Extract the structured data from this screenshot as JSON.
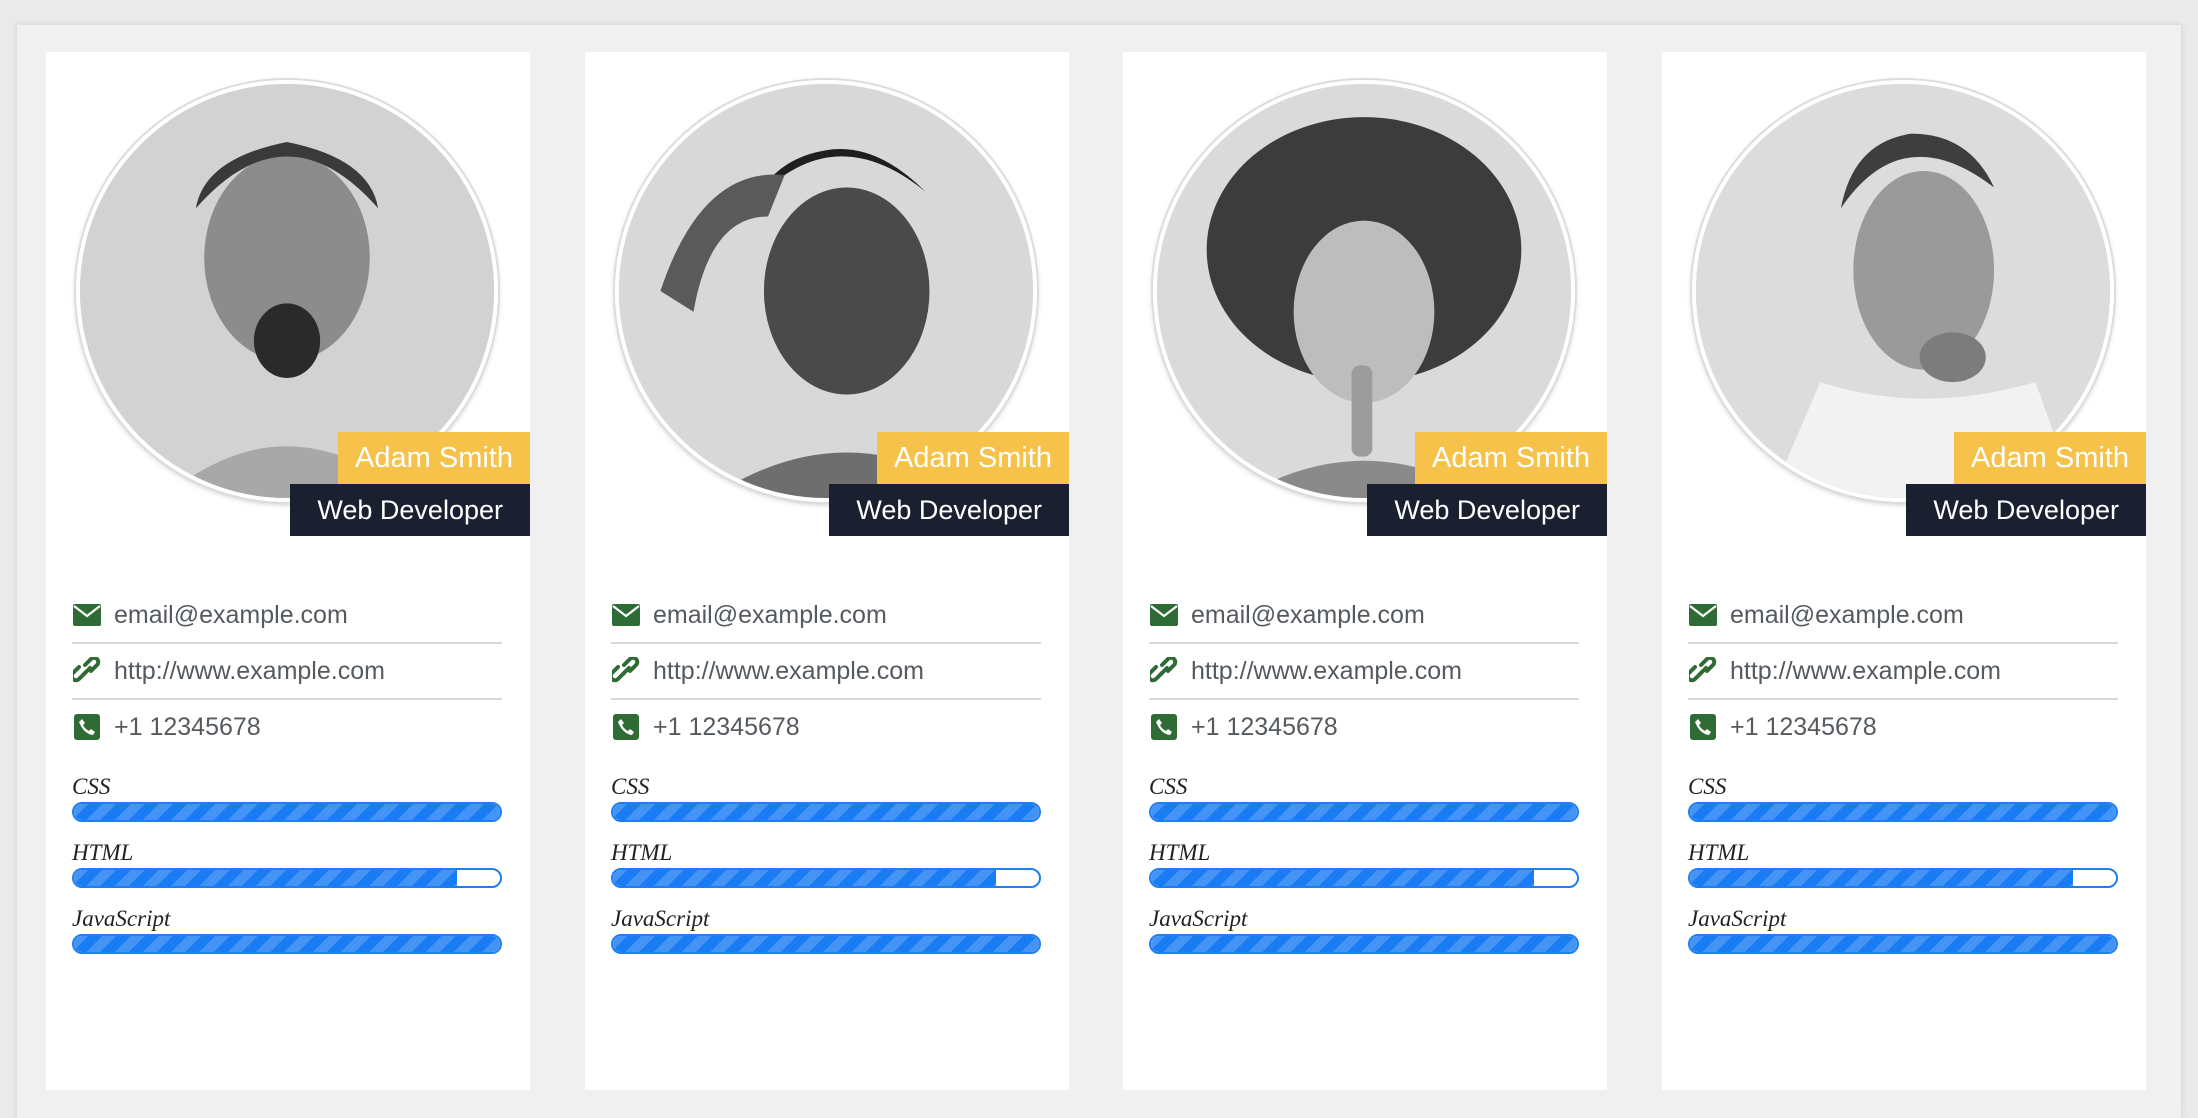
{
  "colors": {
    "name_tag_bg": "#f7c24a",
    "role_tag_bg": "#1b2030",
    "icon_green": "#2e6b35",
    "progress_blue": "#1a7cf2"
  },
  "cards": [
    {
      "name": "Adam Smith",
      "role": "Web Developer",
      "photo": "portrait-man-shouting",
      "email": "email@example.com",
      "website": "http://www.example.com",
      "phone": "+1 12345678",
      "skills": [
        {
          "label": "CSS",
          "percent": 100
        },
        {
          "label": "HTML",
          "percent": 90
        },
        {
          "label": "JavaScript",
          "percent": 100
        }
      ]
    },
    {
      "name": "Adam Smith",
      "role": "Web Developer",
      "photo": "portrait-woman-hand-on-head",
      "email": "email@example.com",
      "website": "http://www.example.com",
      "phone": "+1 12345678",
      "skills": [
        {
          "label": "CSS",
          "percent": 100
        },
        {
          "label": "HTML",
          "percent": 90
        },
        {
          "label": "JavaScript",
          "percent": 100
        }
      ]
    },
    {
      "name": "Adam Smith",
      "role": "Web Developer",
      "photo": "portrait-woman-curly-hair-finger-on-lips",
      "email": "email@example.com",
      "website": "http://www.example.com",
      "phone": "+1 12345678",
      "skills": [
        {
          "label": "CSS",
          "percent": 100
        },
        {
          "label": "HTML",
          "percent": 90
        },
        {
          "label": "JavaScript",
          "percent": 100
        }
      ]
    },
    {
      "name": "Adam Smith",
      "role": "Web Developer",
      "photo": "portrait-man-thinking",
      "email": "email@example.com",
      "website": "http://www.example.com",
      "phone": "+1 12345678",
      "skills": [
        {
          "label": "CSS",
          "percent": 100
        },
        {
          "label": "HTML",
          "percent": 90
        },
        {
          "label": "JavaScript",
          "percent": 100
        }
      ]
    }
  ]
}
